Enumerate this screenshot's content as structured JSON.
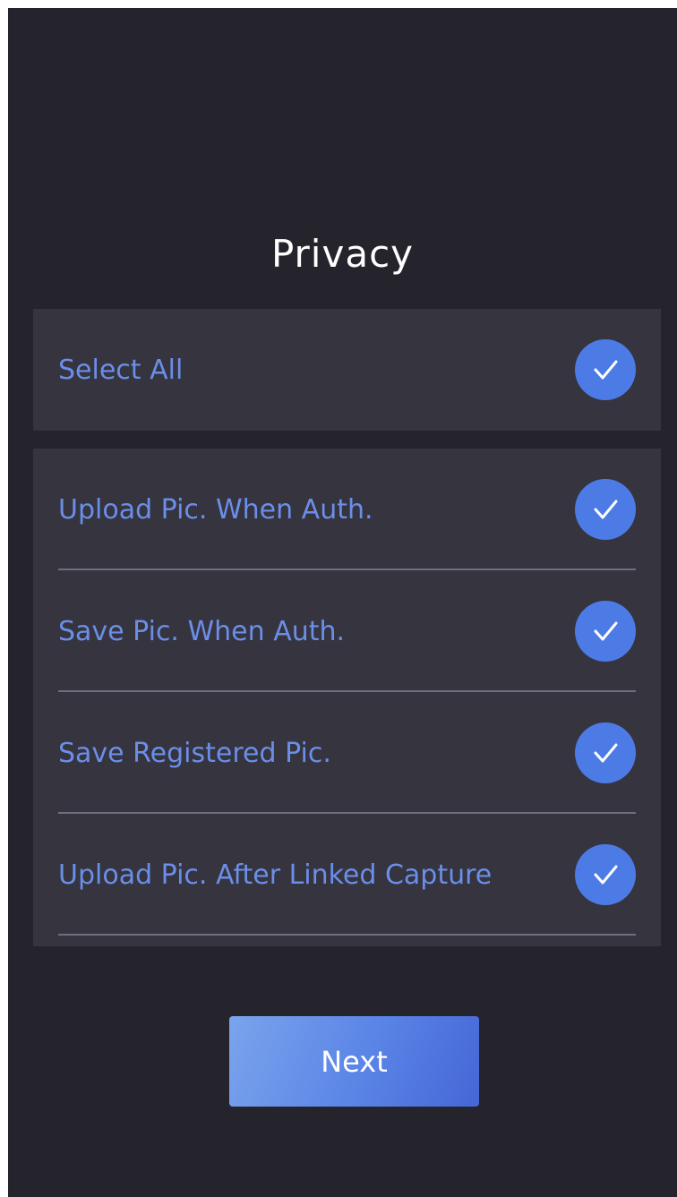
{
  "header": {
    "title": "Privacy"
  },
  "select_all": {
    "label": "Select All",
    "checked": true
  },
  "options": [
    {
      "label": "Upload Pic. When Auth.",
      "checked": true
    },
    {
      "label": "Save Pic. When Auth.",
      "checked": true
    },
    {
      "label": "Save Registered Pic.",
      "checked": true
    },
    {
      "label": "Upload Pic. After Linked Capture",
      "checked": true
    }
  ],
  "footer": {
    "next_label": "Next"
  },
  "colors": {
    "background": "#25242c",
    "panel": "#35343f",
    "accent": "#4d7be6",
    "label_text": "#6b8ee8"
  },
  "icons": {
    "check": "checkmark-icon"
  }
}
